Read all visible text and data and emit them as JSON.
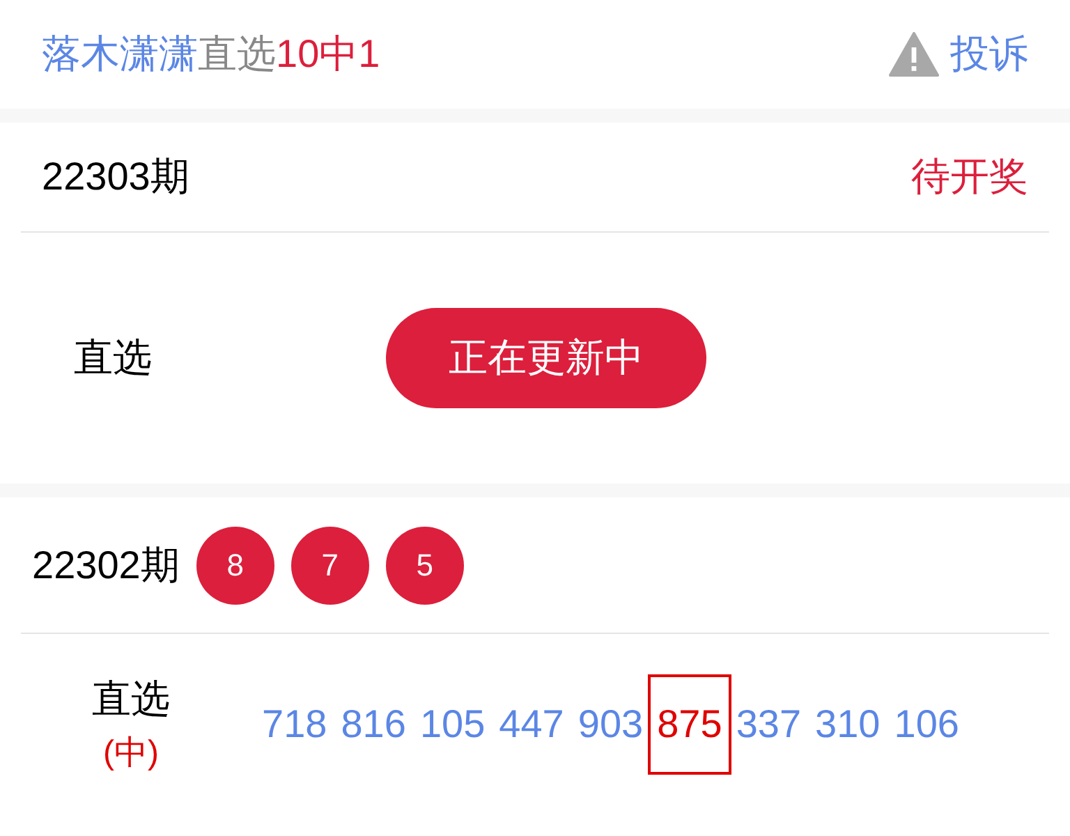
{
  "header": {
    "title_parts": [
      {
        "text": "落木潇潇",
        "kind": "name"
      },
      {
        "text": "直选",
        "kind": "plain"
      },
      {
        "text": "10中1",
        "kind": "record"
      }
    ],
    "complaint": "投诉"
  },
  "current": {
    "issue": "22303期",
    "status": "待开奖",
    "label": "直选",
    "button": "正在更新中"
  },
  "previous": {
    "issue": "22302期",
    "balls": [
      "8",
      "7",
      "5"
    ],
    "label": "直选",
    "result": "(中)",
    "numbers": [
      {
        "text": "718",
        "hit": false
      },
      {
        "text": "816",
        "hit": false
      },
      {
        "text": "105",
        "hit": false
      },
      {
        "text": "447",
        "hit": false
      },
      {
        "text": "903",
        "hit": false
      },
      {
        "text": "875",
        "hit": true
      },
      {
        "text": "337",
        "hit": false
      },
      {
        "text": "310",
        "hit": false
      },
      {
        "text": "106",
        "hit": false
      }
    ]
  }
}
